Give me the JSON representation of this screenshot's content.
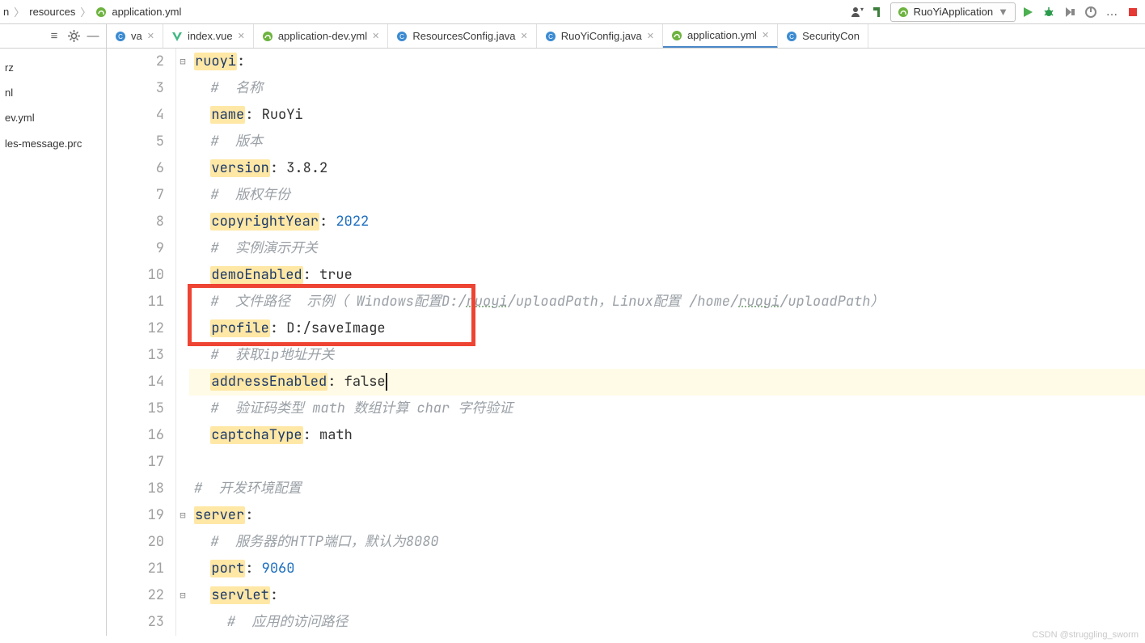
{
  "breadcrumbs": {
    "item0": "n",
    "item1": "resources",
    "item2": "application.yml"
  },
  "run_config": {
    "label": "RuoYiApplication"
  },
  "left_panel": {
    "files": [
      {
        "name": "rz"
      },
      {
        "name": ""
      },
      {
        "name": "nl"
      },
      {
        "name": "ev.yml"
      },
      {
        "name": ""
      },
      {
        "name": "les-message.prc"
      }
    ],
    "top_fragment": "rz"
  },
  "tabs": [
    {
      "id": "va",
      "label": "va",
      "type": "java",
      "active": false
    },
    {
      "id": "index",
      "label": "index.vue",
      "type": "vue",
      "active": false
    },
    {
      "id": "appdev",
      "label": "application-dev.yml",
      "type": "spring",
      "active": false
    },
    {
      "id": "rescfg",
      "label": "ResourcesConfig.java",
      "type": "java",
      "active": false
    },
    {
      "id": "rycfg",
      "label": "RuoYiConfig.java",
      "type": "java",
      "active": false
    },
    {
      "id": "appyml",
      "label": "application.yml",
      "type": "spring",
      "active": true
    },
    {
      "id": "seccon",
      "label": "SecurityCon",
      "type": "java",
      "active": false
    }
  ],
  "code": {
    "first_line_no": 2,
    "last_line_no": 23,
    "highlight_box": {
      "top_line": 11,
      "bottom_line": 13
    },
    "current_line": 14,
    "lines": [
      {
        "n": 2,
        "indent": 0,
        "kind": "key",
        "key": "ruoyi",
        "after": ":"
      },
      {
        "n": 3,
        "indent": 2,
        "kind": "comment",
        "text": "#  名称"
      },
      {
        "n": 4,
        "indent": 2,
        "kind": "kv",
        "key": "name",
        "value": "RuoYi"
      },
      {
        "n": 5,
        "indent": 2,
        "kind": "comment",
        "text": "#  版本"
      },
      {
        "n": 6,
        "indent": 2,
        "kind": "kv",
        "key": "version",
        "value": "3.8.2"
      },
      {
        "n": 7,
        "indent": 2,
        "kind": "comment",
        "text": "#  版权年份"
      },
      {
        "n": 8,
        "indent": 2,
        "kind": "kv",
        "key": "copyrightYear",
        "value": "2022"
      },
      {
        "n": 9,
        "indent": 2,
        "kind": "comment",
        "text": "#  实例演示开关"
      },
      {
        "n": 10,
        "indent": 2,
        "kind": "kv",
        "key": "demoEnabled",
        "value": "true"
      },
      {
        "n": 11,
        "indent": 2,
        "kind": "comment",
        "text": "#  文件路径  示例（ Windows配置D:/ruoyi/uploadPath，Linux配置 /home/ruoyi/uploadPath）"
      },
      {
        "n": 12,
        "indent": 2,
        "kind": "kv",
        "key": "profile",
        "value": "D:/saveImage"
      },
      {
        "n": 13,
        "indent": 2,
        "kind": "comment",
        "text": "#  获取ip地址开关"
      },
      {
        "n": 14,
        "indent": 2,
        "kind": "kv",
        "key": "addressEnabled",
        "value": "false",
        "caret_after": true
      },
      {
        "n": 15,
        "indent": 2,
        "kind": "comment",
        "text": "#  验证码类型 math 数组计算 char 字符验证"
      },
      {
        "n": 16,
        "indent": 2,
        "kind": "kv",
        "key": "captchaType",
        "value": "math"
      },
      {
        "n": 17,
        "indent": 0,
        "kind": "blank"
      },
      {
        "n": 18,
        "indent": 0,
        "kind": "comment",
        "text": "#  开发环境配置"
      },
      {
        "n": 19,
        "indent": 0,
        "kind": "key",
        "key": "server",
        "after": ":"
      },
      {
        "n": 20,
        "indent": 2,
        "kind": "comment",
        "text": "#  服务器的HTTP端口，默认为8080"
      },
      {
        "n": 21,
        "indent": 2,
        "kind": "kvnum",
        "key": "port",
        "value": "9060"
      },
      {
        "n": 22,
        "indent": 2,
        "kind": "key",
        "key": "servlet",
        "after": ":"
      },
      {
        "n": 23,
        "indent": 4,
        "kind": "comment",
        "text": "#  应用的访问路径"
      }
    ]
  },
  "watermark": "CSDN @struggling_sworm"
}
